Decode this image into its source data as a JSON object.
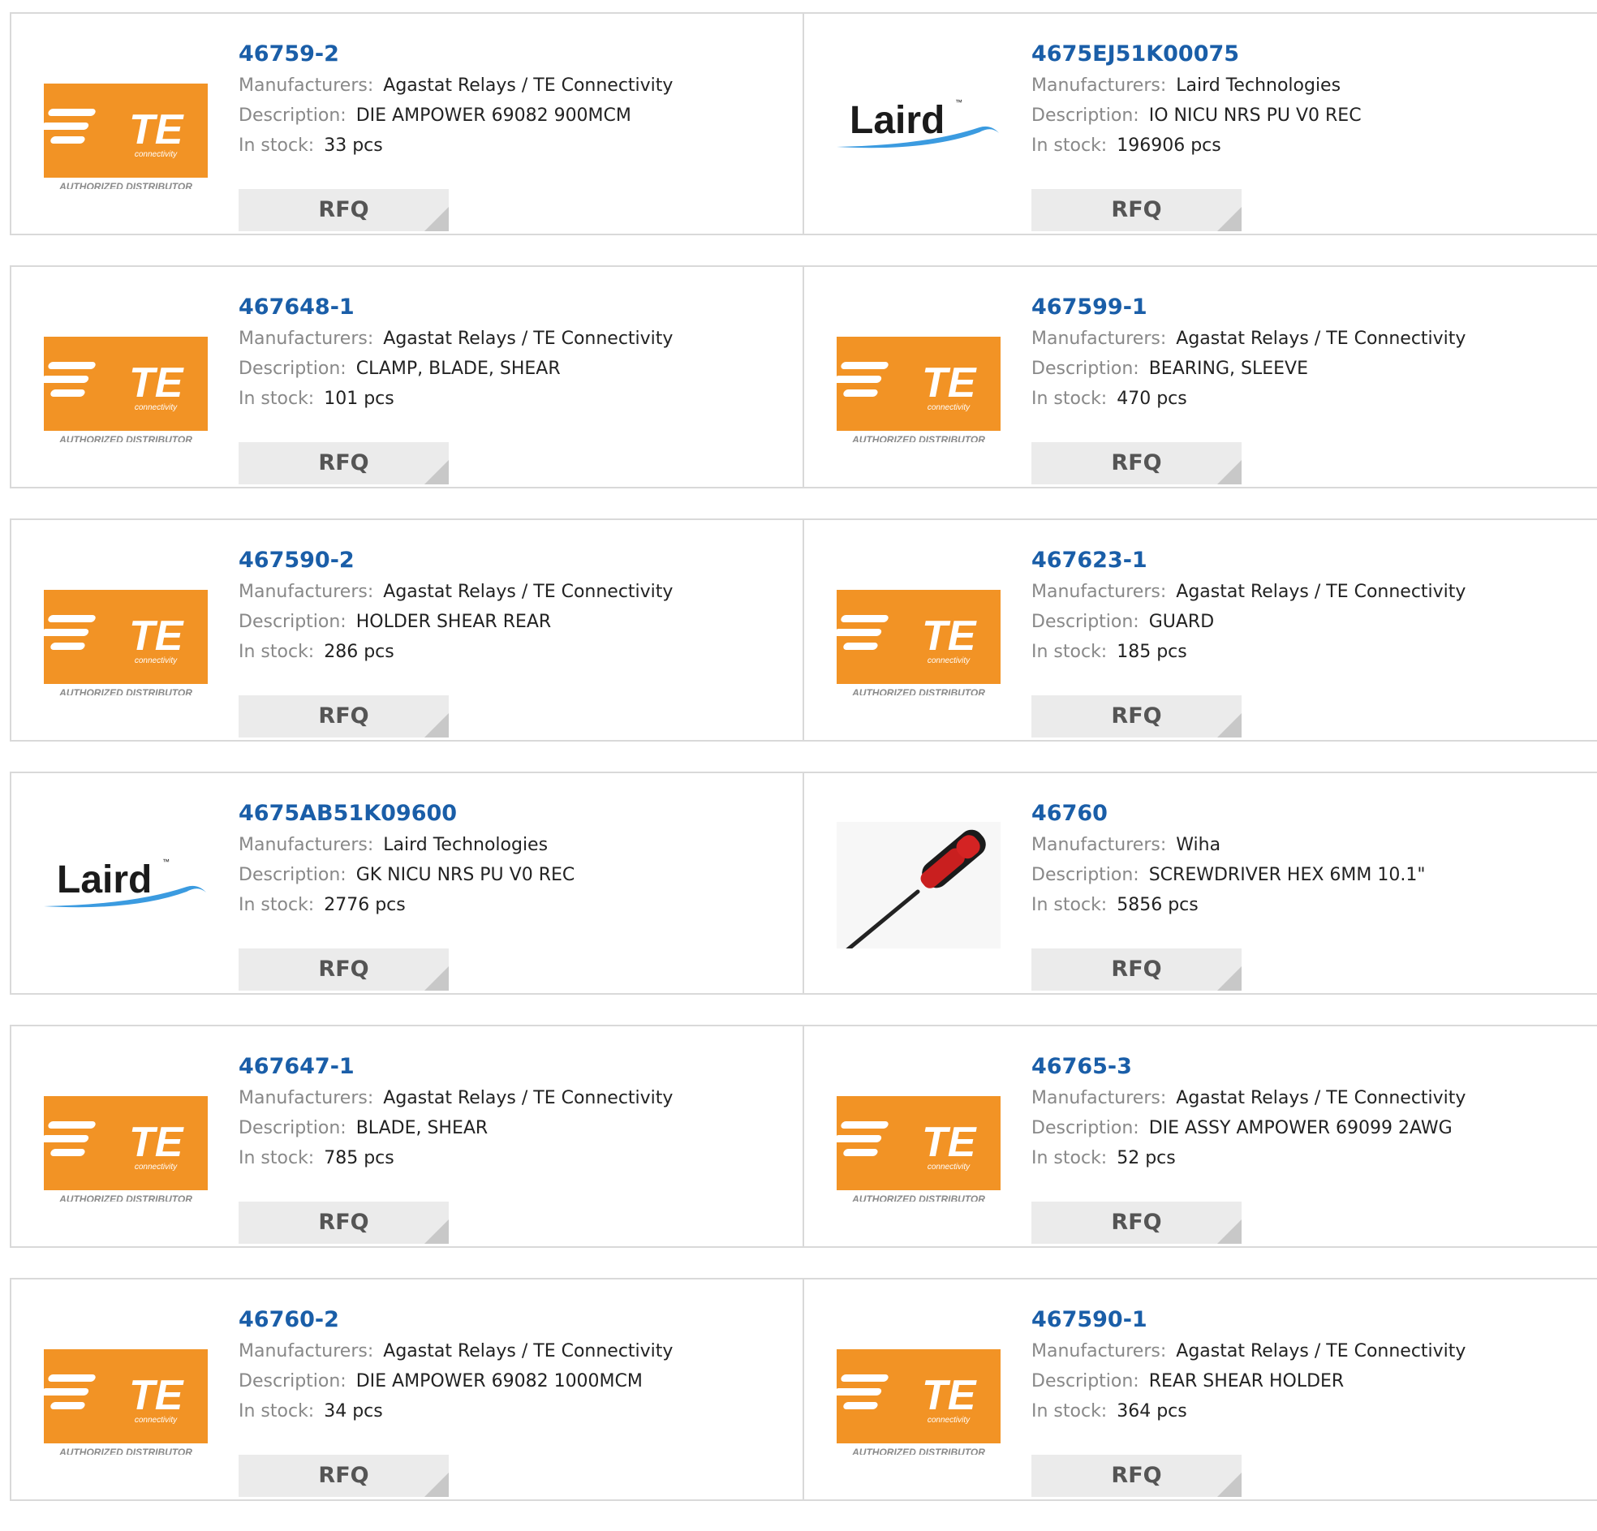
{
  "labels": {
    "manufacturers": "Manufacturers:",
    "description": "Description:",
    "in_stock": "In stock:",
    "rfq": "RFQ"
  },
  "logos": {
    "te": {
      "text": "TE",
      "sub": "connectivity",
      "tag": "AUTHORIZED DISTRIBUTOR",
      "color": "#f29325"
    },
    "laird": {
      "text": "Laird",
      "tm": "™",
      "color": "#3b9be0"
    }
  },
  "products": [
    {
      "pn": "46759-2",
      "manufacturer": "Agastat Relays / TE Connectivity",
      "description": "DIE AMPOWER 69082 900MCM",
      "stock": "33 pcs",
      "logo": "te"
    },
    {
      "pn": "4675EJ51K00075",
      "manufacturer": "Laird Technologies",
      "description": "IO NICU NRS PU V0 REC",
      "stock": "196906 pcs",
      "logo": "laird"
    },
    {
      "pn": "467648-1",
      "manufacturer": "Agastat Relays / TE Connectivity",
      "description": "CLAMP, BLADE, SHEAR",
      "stock": "101 pcs",
      "logo": "te"
    },
    {
      "pn": "467599-1",
      "manufacturer": "Agastat Relays / TE Connectivity",
      "description": "BEARING, SLEEVE",
      "stock": "470 pcs",
      "logo": "te"
    },
    {
      "pn": "467590-2",
      "manufacturer": "Agastat Relays / TE Connectivity",
      "description": "HOLDER SHEAR REAR",
      "stock": "286 pcs",
      "logo": "te"
    },
    {
      "pn": "467623-1",
      "manufacturer": "Agastat Relays / TE Connectivity",
      "description": "GUARD",
      "stock": "185 pcs",
      "logo": "te"
    },
    {
      "pn": "4675AB51K09600",
      "manufacturer": "Laird Technologies",
      "description": "GK NICU NRS PU V0 REC",
      "stock": "2776 pcs",
      "logo": "laird"
    },
    {
      "pn": "46760",
      "manufacturer": "Wiha",
      "description": "SCREWDRIVER HEX 6MM 10.1\"",
      "stock": "5856 pcs",
      "logo": "screwdriver"
    },
    {
      "pn": "467647-1",
      "manufacturer": "Agastat Relays / TE Connectivity",
      "description": "BLADE, SHEAR",
      "stock": "785 pcs",
      "logo": "te"
    },
    {
      "pn": "46765-3",
      "manufacturer": "Agastat Relays / TE Connectivity",
      "description": "DIE ASSY AMPOWER 69099 2AWG",
      "stock": "52 pcs",
      "logo": "te"
    },
    {
      "pn": "46760-2",
      "manufacturer": "Agastat Relays / TE Connectivity",
      "description": "DIE AMPOWER 69082 1000MCM",
      "stock": "34 pcs",
      "logo": "te"
    },
    {
      "pn": "467590-1",
      "manufacturer": "Agastat Relays / TE Connectivity",
      "description": "REAR SHEAR HOLDER",
      "stock": "364 pcs",
      "logo": "te"
    }
  ]
}
